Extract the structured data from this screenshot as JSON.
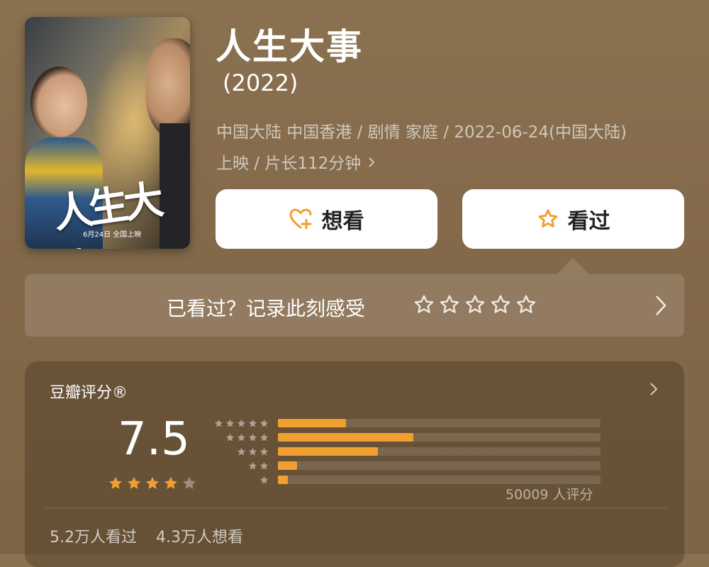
{
  "movie": {
    "title": "人生大事",
    "year": "(2022)",
    "meta_line1": "中国大陆 中国香港 / 剧情 家庭 / 2022-06-24(中国大陆)",
    "meta_line2": "上映 / 片长112分钟",
    "poster_title": "人生大事",
    "poster_release": "6月24日 全国上映"
  },
  "actions": {
    "want_label": "想看",
    "seen_label": "看过"
  },
  "quick_rate": {
    "prompt": "已看过？记录此刻感受",
    "stars": 5
  },
  "rating": {
    "title": "豆瓣评分®",
    "score": "7.5",
    "stars_filled": 4,
    "stars_total": 5,
    "distribution": [
      {
        "stars": 5,
        "fraction": 0.21
      },
      {
        "stars": 4,
        "fraction": 0.42
      },
      {
        "stars": 3,
        "fraction": 0.31
      },
      {
        "stars": 2,
        "fraction": 0.06
      },
      {
        "stars": 1,
        "fraction": 0.03
      }
    ],
    "count_text": "50009 人评分",
    "watched": "5.2万人看过",
    "wanted": "4.3万人想看"
  },
  "colors": {
    "accent": "#f0a030",
    "background": "#85694a"
  },
  "icons": {
    "want": "heart-plus-icon",
    "seen": "star-outline-icon",
    "chevron": "chevron-right-icon"
  }
}
